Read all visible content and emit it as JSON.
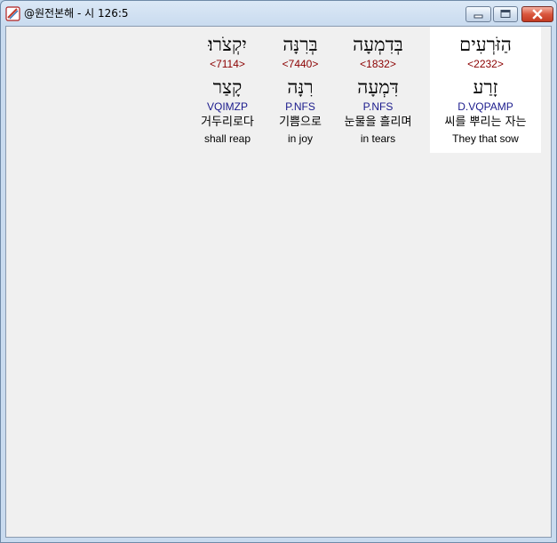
{
  "window": {
    "title": "@원전본해 - 시 126:5",
    "controls": {
      "minimize": "minimize",
      "maximize": "maximize",
      "close": "close"
    }
  },
  "words": [
    {
      "surface": "הַזֹּרְעִים",
      "strongs": "<2232>",
      "lemma": "זָרַע",
      "morph": "D.VQPAMP",
      "korean": "씨를 뿌리는 자는",
      "english": "They that sow"
    },
    {
      "surface": "בְּדִמְעָה",
      "strongs": "<1832>",
      "lemma": "דִּמְעָה",
      "morph": "P.NFS",
      "korean": "눈물을 흘리며",
      "english": "in tears"
    },
    {
      "surface": "בְּרִנָּה",
      "strongs": "<7440>",
      "lemma": "רִנָּה",
      "morph": "P.NFS",
      "korean": "기쁨으로",
      "english": "in joy"
    },
    {
      "surface": "יִקְצֹרוּ׃",
      "strongs": "<7114>",
      "lemma": "קָצַר",
      "morph": "VQIMZP",
      "korean": "거두리로다",
      "english": "shall reap"
    }
  ]
}
